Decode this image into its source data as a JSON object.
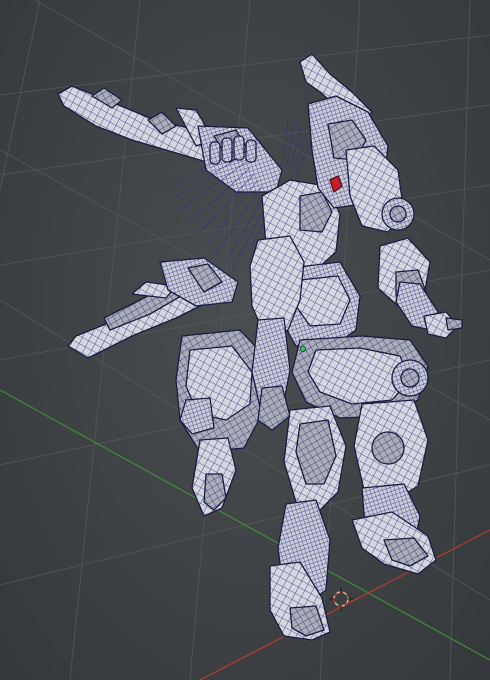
{
  "viewport": {
    "kind": "3d-modeling-viewport",
    "shading": "wireframe-on-shaded",
    "colors": {
      "background": "#3d4144",
      "grid": "#5a5f62",
      "x_axis": "#b83a32",
      "y_axis": "#3f8d3a",
      "mesh_fill": "#d4d7dc",
      "mesh_shadow": "#9ea3ab",
      "wire": "#2b2f8f",
      "outline": "#1a1c3f",
      "accent_red": "#c8202b",
      "cursor": "#d9b98a"
    },
    "icons": {
      "cursor": "3d-cursor-icon",
      "origin": "object-origin-icon"
    }
  }
}
